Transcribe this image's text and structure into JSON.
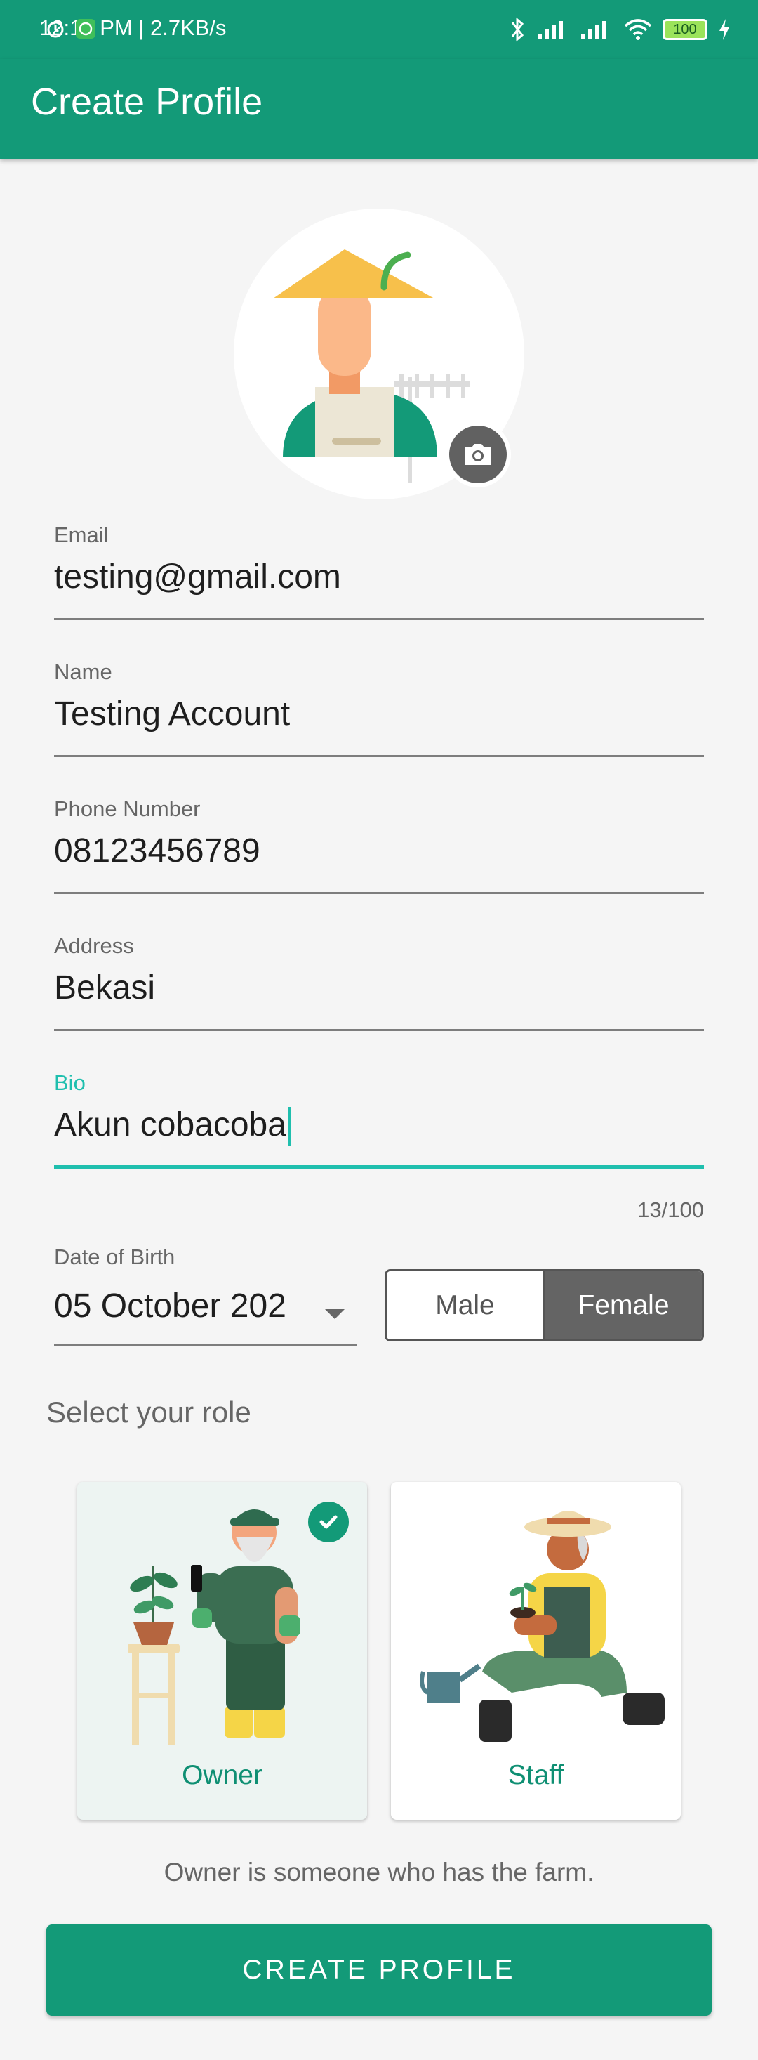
{
  "status_bar": {
    "time": "12:14 PM | 2.7KB/s",
    "battery": "100"
  },
  "app_bar": {
    "title": "Create Profile"
  },
  "form": {
    "email": {
      "label": "Email",
      "value": "testing@gmail.com"
    },
    "name": {
      "label": "Name",
      "value": "Testing Account"
    },
    "phone": {
      "label": "Phone Number",
      "value": "08123456789"
    },
    "address": {
      "label": "Address",
      "value": "Bekasi"
    },
    "bio": {
      "label": "Bio",
      "value": "Akun cobacoba",
      "counter": "13/100"
    },
    "dob": {
      "label": "Date of Birth",
      "value": "05 October 202"
    },
    "gender": {
      "options": [
        "Male",
        "Female"
      ],
      "selected": "Female"
    }
  },
  "role": {
    "heading": "Select your role",
    "options": [
      {
        "label": "Owner",
        "selected": true
      },
      {
        "label": "Staff",
        "selected": false
      }
    ],
    "description": "Owner is someone who has the farm."
  },
  "actions": {
    "create_label": "CREATE PROFILE"
  },
  "colors": {
    "primary": "#139a78",
    "accent": "#1fbfae",
    "selected_toggle": "#646464"
  }
}
